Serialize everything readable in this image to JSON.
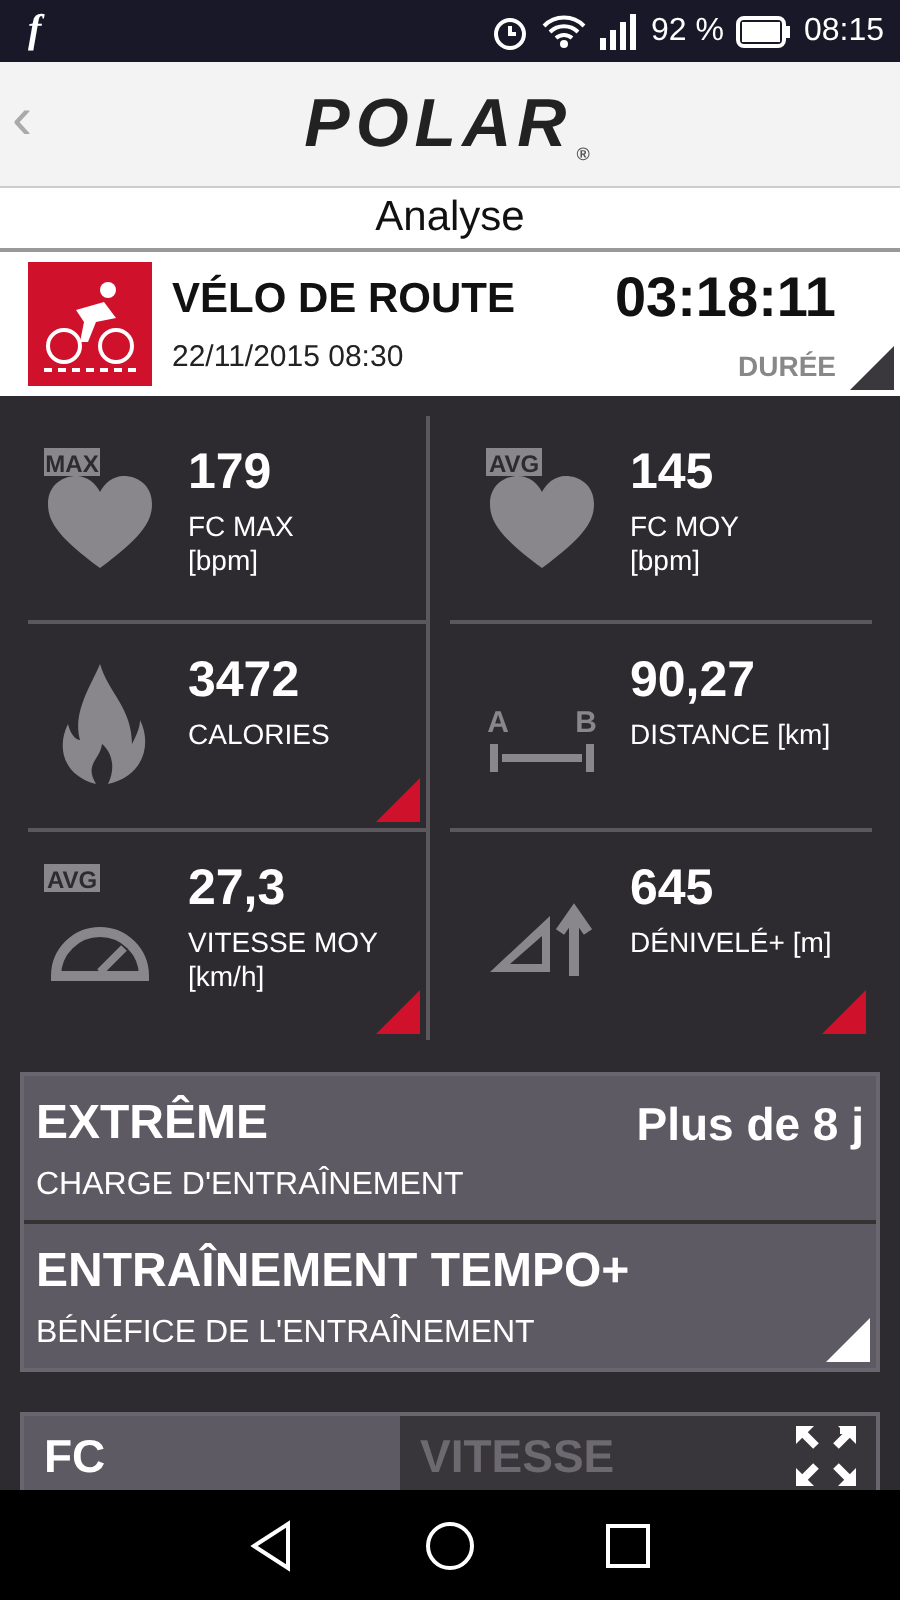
{
  "status_bar": {
    "app_glyph": "f",
    "battery": "92 %",
    "time": "08:15"
  },
  "header": {
    "back": "‹",
    "logo": "POLAR",
    "logo_mark": "®"
  },
  "page_title": "Analyse",
  "activity": {
    "sport": "VÉLO DE ROUTE",
    "date": "22/11/2015 08:30",
    "duration": "03:18:11",
    "duration_label": "DURÉE",
    "expandable": true
  },
  "metrics": [
    {
      "kind": "heart",
      "icon_text": [
        "MAX"
      ],
      "value": "179",
      "label": "FC MAX",
      "unit": "[bpm]",
      "expandable": false
    },
    {
      "kind": "heart",
      "icon_text": [
        "AVG"
      ],
      "value": "145",
      "label": "FC MOY",
      "unit": "[bpm]",
      "expandable": false
    },
    {
      "kind": "flame",
      "value": "3472",
      "label": "CALORIES",
      "expandable": true
    },
    {
      "kind": "distance",
      "icon_text": [
        "A",
        "B"
      ],
      "value": "90,27",
      "label": "DISTANCE [km]",
      "expandable": false
    },
    {
      "kind": "speed",
      "icon_text": [
        "AVG"
      ],
      "value": "27,3",
      "label": "VITESSE MOY",
      "unit": "[km/h]",
      "expandable": true
    },
    {
      "kind": "ascent",
      "value": "645",
      "label": "DÉNIVELÉ+ [m]",
      "expandable": true
    }
  ],
  "training": [
    {
      "title": "EXTRÊME",
      "value": "Plus de 8 j",
      "subtitle": "CHARGE D'ENTRAÎNEMENT",
      "expandable": false
    },
    {
      "title": "ENTRAÎNEMENT TEMPO+",
      "subtitle": "BÉNÉFICE DE L'ENTRAÎNEMENT",
      "expandable": true
    }
  ],
  "chart_tabs": [
    {
      "label": "FC",
      "selected": true
    },
    {
      "label": "VITESSE",
      "selected": false
    }
  ]
}
